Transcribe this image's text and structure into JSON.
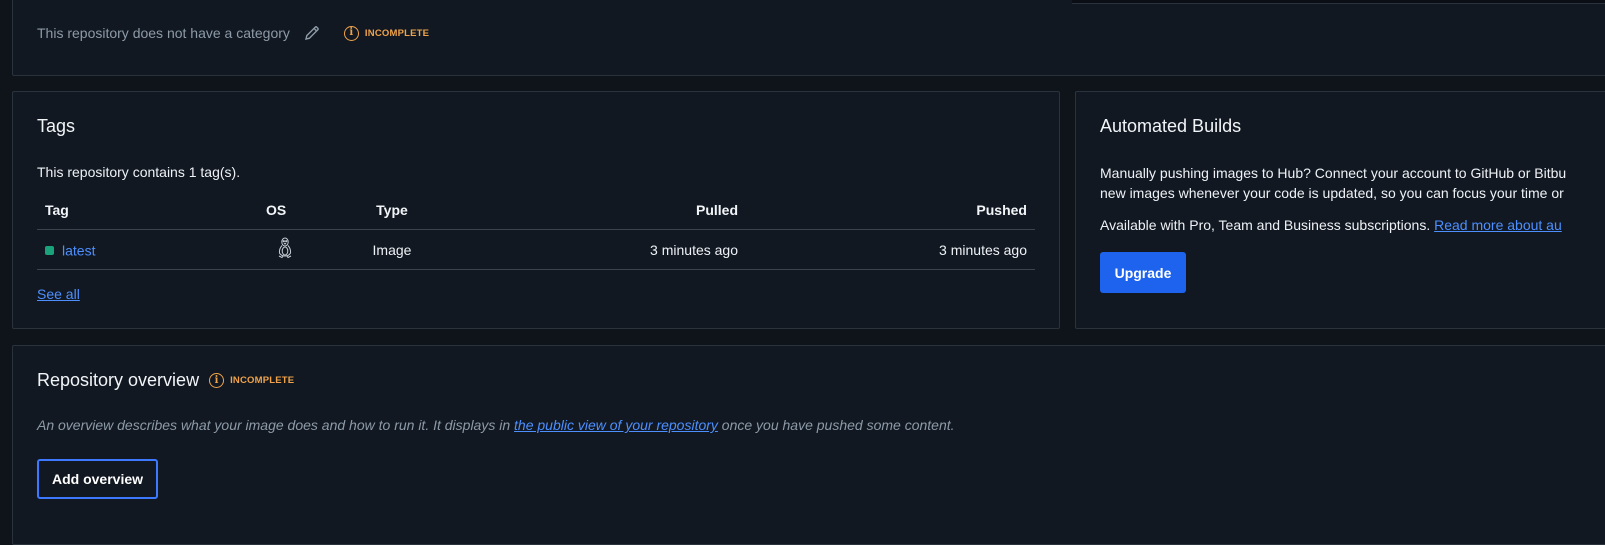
{
  "category": {
    "text": "This repository does not have a category",
    "status": "INCOMPLETE"
  },
  "tags": {
    "title": "Tags",
    "summary": "This repository contains 1 tag(s).",
    "columns": {
      "tag": "Tag",
      "os": "OS",
      "type": "Type",
      "pulled": "Pulled",
      "pushed": "Pushed"
    },
    "rows": [
      {
        "tag": "latest",
        "os_icon": "linux-penguin-icon",
        "type": "Image",
        "pulled": "3 minutes ago",
        "pushed": "3 minutes ago"
      }
    ],
    "see_all": "See all"
  },
  "builds": {
    "title": "Automated Builds",
    "line1": "Manually pushing images to Hub? Connect your account to GitHub or Bitbu",
    "line2": "new images whenever your code is updated, so you can focus your time or",
    "availability": "Available with Pro, Team and Business subscriptions.",
    "read_more": "Read more about au",
    "upgrade_label": "Upgrade"
  },
  "overview": {
    "title": "Repository overview",
    "status": "INCOMPLETE",
    "desc_before": "An overview describes what your image does and how to run it. It displays in ",
    "desc_link": "the public view of your repository",
    "desc_after": " once you have pushed some content.",
    "add_label": "Add overview"
  },
  "colors": {
    "background": "#0f141b",
    "card": "#111821",
    "border": "#2a323c",
    "link": "#4d8fff",
    "primary_button": "#1d63ed",
    "warning": "#f0a34a",
    "tag_dot": "#1aa37a"
  }
}
